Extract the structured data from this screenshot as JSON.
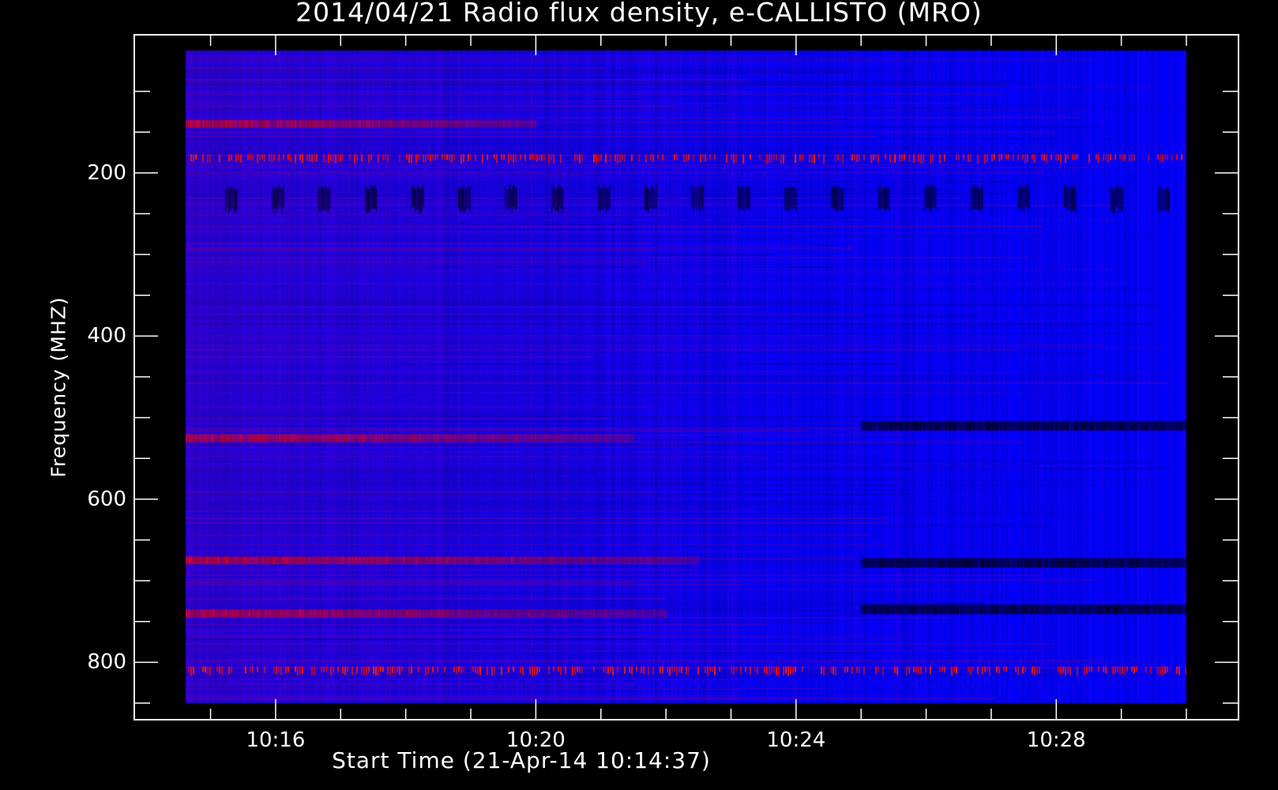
{
  "chart_data": {
    "type": "heatmap",
    "title": "2014/04/21  Radio flux density, e-CALLISTO (MRO)",
    "xlabel": "Start Time (21-Apr-14 10:14:37)",
    "ylabel": "Frequency (MHZ)",
    "y_inverted": true,
    "ylim": [
      50,
      850
    ],
    "xlim": [
      "10:14:37",
      "10:30:00"
    ],
    "yticks": [
      200,
      400,
      600,
      800
    ],
    "xticks": [
      "10:16",
      "10:20",
      "10:24",
      "10:28"
    ],
    "colormap": [
      "#000000",
      "#0000ff",
      "#ff0000"
    ],
    "background_color": "#0000ff",
    "features": [
      {
        "kind": "red band",
        "freq": 140,
        "from": "10:14:37",
        "to": "10:20:00"
      },
      {
        "kind": "dotted red band",
        "freq": 180,
        "from": "10:14:37",
        "to": "10:30:00"
      },
      {
        "kind": "periodic dark bursts",
        "freq": 230,
        "from": "10:14:37",
        "to": "10:30:00"
      },
      {
        "kind": "red band",
        "freq": 525,
        "from": "10:14:37",
        "to": "10:21:30"
      },
      {
        "kind": "dark band",
        "freq": 510,
        "from": "10:25:00",
        "to": "10:30:00"
      },
      {
        "kind": "red band",
        "freq": 675,
        "from": "10:14:37",
        "to": "10:22:30"
      },
      {
        "kind": "dark band",
        "freq": 678,
        "from": "10:25:00",
        "to": "10:30:00"
      },
      {
        "kind": "red band",
        "freq": 740,
        "from": "10:14:37",
        "to": "10:22:00"
      },
      {
        "kind": "dark band",
        "freq": 735,
        "from": "10:25:00",
        "to": "10:30:00"
      },
      {
        "kind": "dotted red band",
        "freq": 808,
        "from": "10:14:37",
        "to": "10:30:00"
      }
    ]
  }
}
